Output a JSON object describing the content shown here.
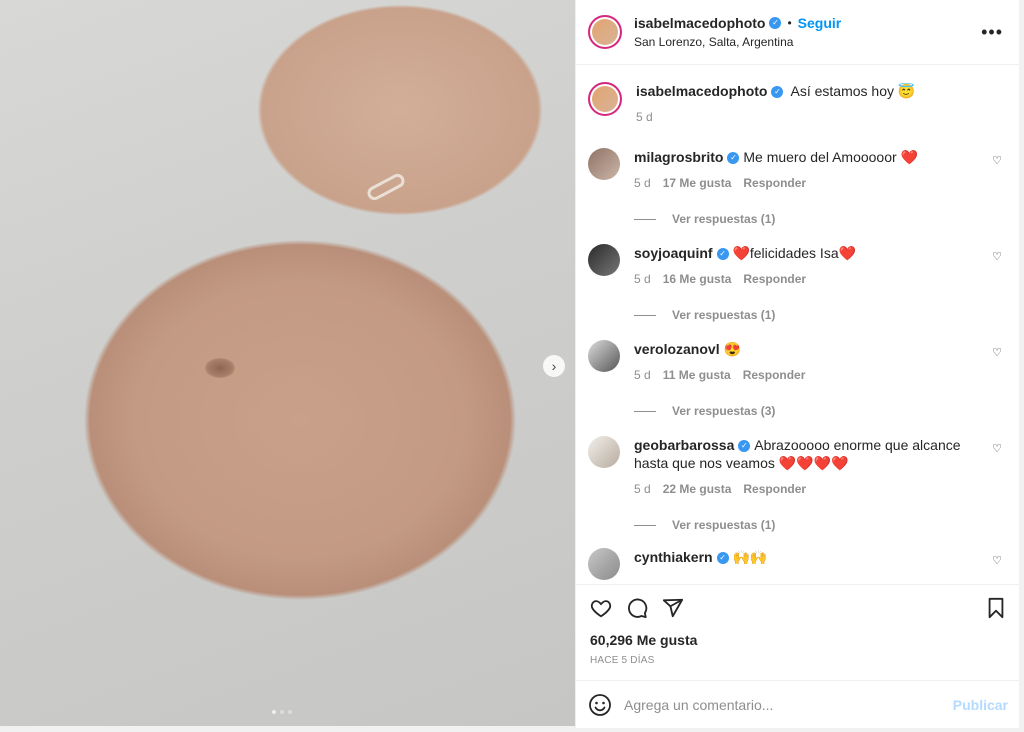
{
  "header": {
    "username": "isabelmacedophoto",
    "dot": "•",
    "follow_label": "Seguir",
    "location": "San Lorenzo, Salta, Argentina"
  },
  "caption": {
    "username": "isabelmacedophoto",
    "text": "Así estamos hoy 😇",
    "time": "5 d"
  },
  "comments": [
    {
      "username": "milagrosbrito",
      "text": "Me muero del Amooooor ❤️",
      "time": "5 d",
      "likes": "17 Me gusta",
      "reply": "Responder",
      "replies": "Ver respuestas (1)"
    },
    {
      "username": "soyjoaquinf",
      "text": "❤️felicidades Isa❤️",
      "time": "5 d",
      "likes": "16 Me gusta",
      "reply": "Responder",
      "replies": "Ver respuestas (1)"
    },
    {
      "username": "verolozanovl",
      "text": "😍",
      "time": "5 d",
      "likes": "11 Me gusta",
      "reply": "Responder",
      "replies": "Ver respuestas (3)"
    },
    {
      "username": "geobarbarossa",
      "text": "Abrazooooo enorme que alcance hasta que nos veamos ❤️❤️❤️❤️",
      "time": "5 d",
      "likes": "22 Me gusta",
      "reply": "Responder",
      "replies": "Ver respuestas (1)"
    },
    {
      "username": "cynthiakern",
      "text": "🙌🙌"
    }
  ],
  "stats": {
    "likes": "60,296 Me gusta",
    "ago": "HACE 5 DÍAS"
  },
  "add_comment": {
    "placeholder": "Agrega un comentario...",
    "publish_label": "Publicar"
  },
  "icons": {
    "more": "more-options-icon",
    "like": "heart-icon",
    "comment": "comment-icon",
    "share": "share-icon",
    "save": "bookmark-icon",
    "emoji": "emoji-icon",
    "next": "chevron-right-icon"
  },
  "colors": {
    "link_blue": "#0095f6",
    "verified_blue": "#3897f0",
    "muted": "#8e8e8e",
    "text": "#262626"
  }
}
